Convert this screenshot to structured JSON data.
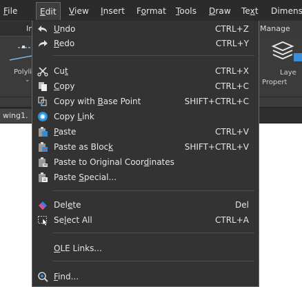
{
  "menubar": {
    "file": "File",
    "edit": "Edit",
    "view": "View",
    "insert": "Insert",
    "format": "Format",
    "tools": "Tools",
    "draw": "Draw",
    "text": "Text",
    "dimension": "Dimens"
  },
  "ribbon": {
    "tab_partial": "In",
    "tab_manage": "Manage",
    "polyline_label": "Polyli",
    "layer_label_1": "Laye",
    "layer_label_2": "Propert"
  },
  "doc_tab": "wing1.",
  "colors": {
    "menu_bg": "#333333",
    "menubar_bg": "#2b2b2b",
    "text": "#e6e6e6",
    "separator": "#4e4e4e"
  },
  "menu_items": {
    "undo": {
      "label": "Undo",
      "shortcut": "CTRL+Z",
      "icon": "undo-arrow-icon"
    },
    "redo": {
      "label": "Redo",
      "shortcut": "CTRL+Y",
      "icon": "redo-arrow-icon"
    },
    "cut": {
      "label": "Cut",
      "shortcut": "CTRL+X",
      "icon": "scissors-icon"
    },
    "copy": {
      "label": "Copy",
      "shortcut": "CTRL+C",
      "icon": "copy-icon"
    },
    "copy_base": {
      "label": "Copy with Base Point",
      "shortcut": "SHIFT+CTRL+C",
      "icon": "copy-base-point-icon"
    },
    "copy_link": {
      "label": "Copy Link",
      "shortcut": "",
      "icon": "copy-link-icon"
    },
    "paste": {
      "label": "Paste",
      "shortcut": "CTRL+V",
      "icon": "paste-icon"
    },
    "paste_block": {
      "label": "Paste as Block",
      "shortcut": "SHIFT+CTRL+V",
      "icon": "paste-block-icon"
    },
    "paste_orig": {
      "label": "Paste to Original Coordinates",
      "shortcut": "",
      "icon": "paste-original-icon"
    },
    "paste_special": {
      "label": "Paste Special...",
      "shortcut": "",
      "icon": "paste-special-icon"
    },
    "delete": {
      "label": "Delete",
      "shortcut": "Del",
      "icon": "eraser-icon"
    },
    "select_all": {
      "label": "Select All",
      "shortcut": "CTRL+A",
      "icon": "select-all-icon"
    },
    "ole_links": {
      "label": "OLE Links...",
      "shortcut": "",
      "icon": ""
    },
    "find": {
      "label": "Find...",
      "shortcut": "",
      "icon": "find-icon"
    }
  }
}
